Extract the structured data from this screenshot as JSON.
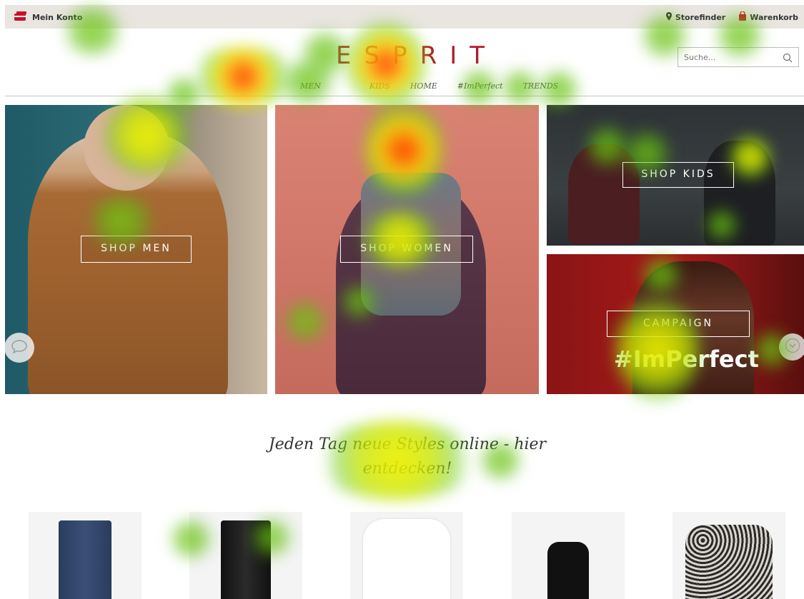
{
  "topbar": {
    "account_label": "Mein Konto",
    "storefinder_label": "Storefinder",
    "cart_label": "Warenkorb"
  },
  "logo": {
    "text": "ESPRIT"
  },
  "search": {
    "placeholder": "Suche..."
  },
  "nav": {
    "items": [
      {
        "label": "MEN"
      },
      {
        "label": "KIDS"
      },
      {
        "label": "HOME"
      },
      {
        "label": "#ImPerfect"
      },
      {
        "label": "TRENDS"
      }
    ]
  },
  "hero": {
    "men_cta": "SHOP MEN",
    "women_cta": "SHOP WOMEN",
    "kids_cta": "SHOP KIDS",
    "campaign_cta": "CAMPAIGN",
    "campaign_hashtag": "#ImPerfect"
  },
  "tagline": {
    "text": "Jeden Tag neue Styles online - hier entdecken!"
  },
  "colors": {
    "brand": "#b01c2e",
    "topbar_bg": "#e9e5e0"
  }
}
